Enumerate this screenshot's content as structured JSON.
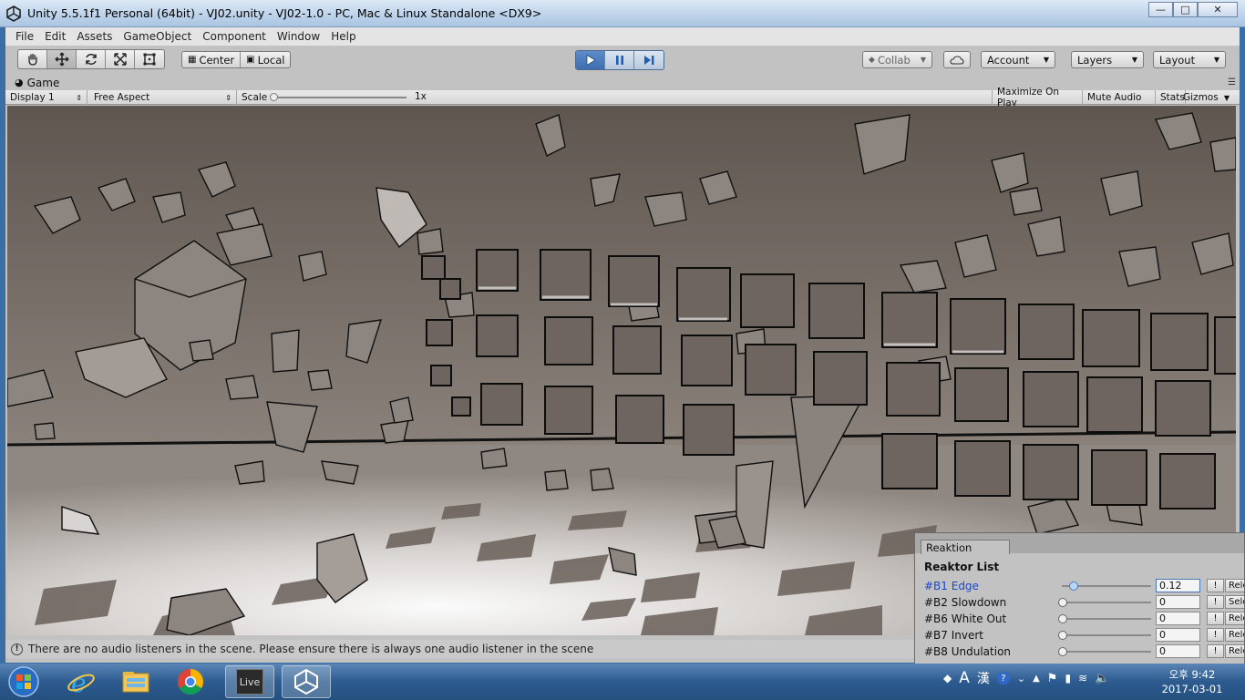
{
  "window": {
    "title": "Unity 5.5.1f1 Personal (64bit) - VJ02.unity - VJ02-1.0 - PC, Mac & Linux Standalone <DX9>",
    "minimize_icon": "minimize-icon",
    "maximize_icon": "maximize-icon",
    "close_icon": "close-icon"
  },
  "menubar": {
    "items": [
      "File",
      "Edit",
      "Assets",
      "GameObject",
      "Component",
      "Window",
      "Help"
    ]
  },
  "toolbar": {
    "transform_tools": [
      "hand-icon",
      "move-icon",
      "rotate-icon",
      "scale-icon",
      "rect-icon"
    ],
    "pivot_label": "Center",
    "space_label": "Local",
    "play_controls": [
      "play-icon",
      "pause-icon",
      "step-icon"
    ],
    "collab_label": "Collab",
    "account_label": "Account",
    "layers_label": "Layers",
    "layout_label": "Layout"
  },
  "game_view": {
    "tab_label": "Game",
    "display": "Display 1",
    "aspect": "Free Aspect",
    "scale_label": "Scale",
    "scale_value": "1x",
    "maximize_on_play": "Maximize On Play",
    "mute_audio": "Mute Audio",
    "stats": "Stats",
    "gizmos": "Gizmos"
  },
  "status": {
    "message": "There are no audio listeners in the scene. Please ensure there is always one audio listener in the scene"
  },
  "reaktion": {
    "tab_label": "Reaktion",
    "header": "Reaktor List",
    "rows": [
      {
        "name": "#B1 Edge",
        "value": "0.12",
        "level": 0.12,
        "bang": "!",
        "release": "Rele",
        "selected": true
      },
      {
        "name": "#B2 Slowdown",
        "value": "0",
        "level": 0,
        "bang": "!",
        "release": "Sele",
        "selected": false
      },
      {
        "name": "#B6 White Out",
        "value": "0",
        "level": 0,
        "bang": "!",
        "release": "Rele",
        "selected": false
      },
      {
        "name": "#B7 Invert",
        "value": "0",
        "level": 0,
        "bang": "!",
        "release": "Rele",
        "selected": false
      },
      {
        "name": "#B8 Undulation",
        "value": "0",
        "level": 0,
        "bang": "!",
        "release": "Rele",
        "selected": false
      }
    ]
  },
  "taskbar": {
    "apps": [
      "internet-explorer-icon",
      "file-explorer-icon",
      "chrome-icon",
      "live-icon",
      "unity-icon"
    ],
    "live_label": "Live",
    "ime_a": "A",
    "ime_han": "漢",
    "time": "오후 9:42",
    "date": "2017-03-01"
  },
  "colors": {
    "selected_text": "#1d47c6",
    "play_active": "#3f6db0",
    "viewport_wall": "#6b615b",
    "taskbar": "#2d5b8f"
  }
}
